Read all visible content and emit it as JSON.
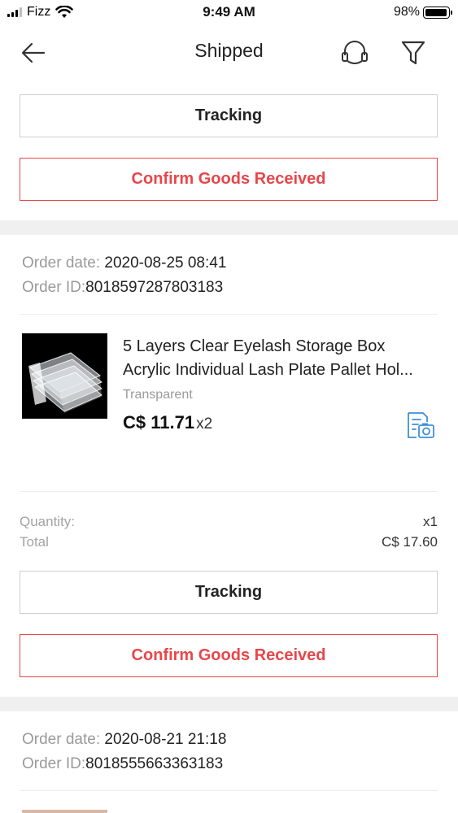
{
  "status_bar": {
    "carrier": "Fizz",
    "time": "9:49 AM",
    "battery_percent": "98%",
    "battery_level": 0.98
  },
  "nav": {
    "title": "Shipped",
    "back_icon": "arrow-left-icon",
    "support_icon": "headset-icon",
    "filter_icon": "filter-icon"
  },
  "top_actions": {
    "tracking_label": "Tracking",
    "confirm_label": "Confirm Goods Received"
  },
  "orders": [
    {
      "order_date_label": "Order date: ",
      "order_date": "2020-08-25 08:41",
      "order_id_label": "Order ID:",
      "order_id": "8018597287803183",
      "product": {
        "title_line1": "5 Layers Clear Eyelash Storage Box",
        "title_line2": "Acrylic Individual Lash Plate Pallet Hol...",
        "variant": "Transparent",
        "price": "C$ 11.71",
        "quantity_multiplier": "x2"
      },
      "quantity_label": "Quantity:",
      "quantity_value": "x1",
      "total_label": "Total",
      "total_value": "C$ 17.60",
      "tracking_label": "Tracking",
      "confirm_label": "Confirm Goods Received"
    },
    {
      "order_date_label": "Order date: ",
      "order_date": "2020-08-21 21:18",
      "order_id_label": "Order ID:",
      "order_id": "8018555663363183"
    }
  ],
  "colors": {
    "accent_red": "#e8464a",
    "separator": "#f0f0f0",
    "muted_text": "#9a9a9a",
    "review_icon_blue": "#3f8fd8"
  }
}
